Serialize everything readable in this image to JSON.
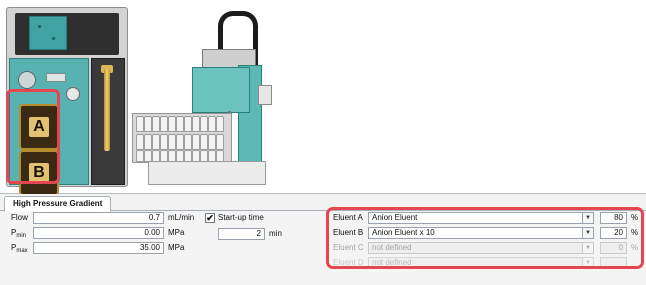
{
  "instrument": {
    "pump_a_label": "A",
    "pump_b_label": "B"
  },
  "tab": {
    "label": "High Pressure Gradient"
  },
  "flow": {
    "label": "Flow",
    "value": "0.7",
    "unit": "mL/min"
  },
  "pmin": {
    "label_main": "P",
    "label_sub": "min",
    "value": "0.00",
    "unit": "MPa"
  },
  "pmax": {
    "label_main": "P",
    "label_sub": "max",
    "value": "35.00",
    "unit": "MPa"
  },
  "startup": {
    "checked": true,
    "check_mark": "✔",
    "label": "Start-up time",
    "value": "2",
    "unit": "min"
  },
  "eluents": [
    {
      "label": "Eluent A",
      "selected": "Anion Eluent",
      "percent": "80",
      "unit": "%",
      "enabled": true
    },
    {
      "label": "Eluent B",
      "selected": "Anion Eluent x 10",
      "percent": "20",
      "unit": "%",
      "enabled": true
    },
    {
      "label": "Eluent C",
      "selected": "not defined",
      "percent": "0",
      "unit": "%",
      "enabled": false
    },
    {
      "label": "Eluent D",
      "selected": "not defined",
      "percent": "",
      "unit": "",
      "enabled": false
    }
  ],
  "colors": {
    "highlight": "#e4474f",
    "instrument_teal": "#57b2b1",
    "panel_bg": "#f2f2f2"
  }
}
